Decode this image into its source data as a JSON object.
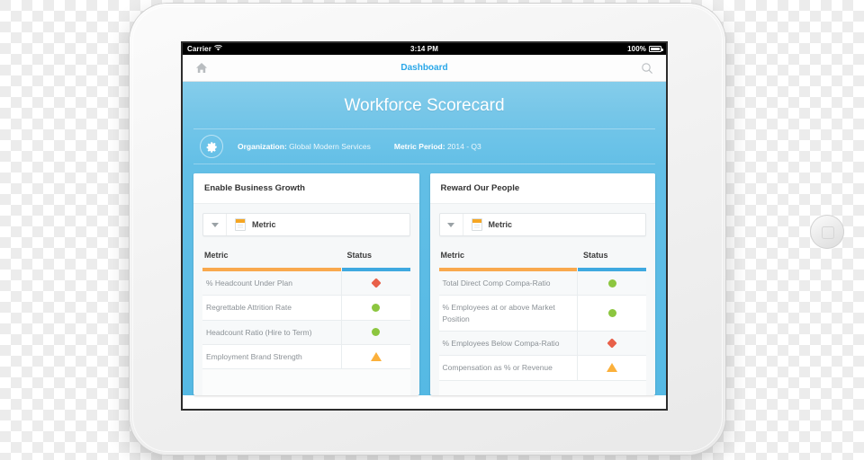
{
  "status_bar": {
    "carrier": "Carrier",
    "wifi_icon": "wifi-icon",
    "time": "3:14 PM",
    "battery_percent": "100%",
    "battery_icon": "battery-icon"
  },
  "nav_bar": {
    "home_icon": "home-icon",
    "title": "Dashboard",
    "search_icon": "search-icon",
    "title_color": "#2aa7e8"
  },
  "hero": {
    "title": "Workforce Scorecard",
    "gear_icon": "gear-icon",
    "organization_label": "Organization:",
    "organization_value": "Global Modern Services",
    "metric_period_label": "Metric Period:",
    "metric_period_value": "2014 - Q3",
    "background_color": "#6cc3e8"
  },
  "colors": {
    "accent_orange": "#f9a94e",
    "accent_blue": "#3fa9e0",
    "status_green": "#8cc63f",
    "status_red": "#e8614a",
    "status_yellow": "#fbb03b"
  },
  "cards": [
    {
      "title": "Enable Business Growth",
      "dropdown": {
        "caret_icon": "chevron-down-icon",
        "doc_icon": "document-icon",
        "label": "Metric"
      },
      "columns": {
        "metric": "Metric",
        "status": "Status"
      },
      "rows": [
        {
          "metric": "% Headcount Under Plan",
          "status": "red-diamond"
        },
        {
          "metric": "Regrettable Attrition Rate",
          "status": "green-circle"
        },
        {
          "metric": "Headcount Ratio (Hire to Term)",
          "status": "green-circle"
        },
        {
          "metric": "Employment Brand Strength",
          "status": "yellow-triangle"
        }
      ]
    },
    {
      "title": "Reward Our People",
      "dropdown": {
        "caret_icon": "chevron-down-icon",
        "doc_icon": "document-icon",
        "label": "Metric"
      },
      "columns": {
        "metric": "Metric",
        "status": "Status"
      },
      "rows": [
        {
          "metric": "Total Direct Comp Compa-Ratio",
          "status": "green-circle"
        },
        {
          "metric": "% Employees at or above Market Position",
          "status": "green-circle"
        },
        {
          "metric": "% Employees Below Compa-Ratio",
          "status": "red-diamond"
        },
        {
          "metric": "Compensation as % or Revenue",
          "status": "yellow-triangle"
        }
      ]
    }
  ],
  "device": {
    "camera_icon": "camera-icon",
    "home_button_icon": "home-button-icon"
  }
}
